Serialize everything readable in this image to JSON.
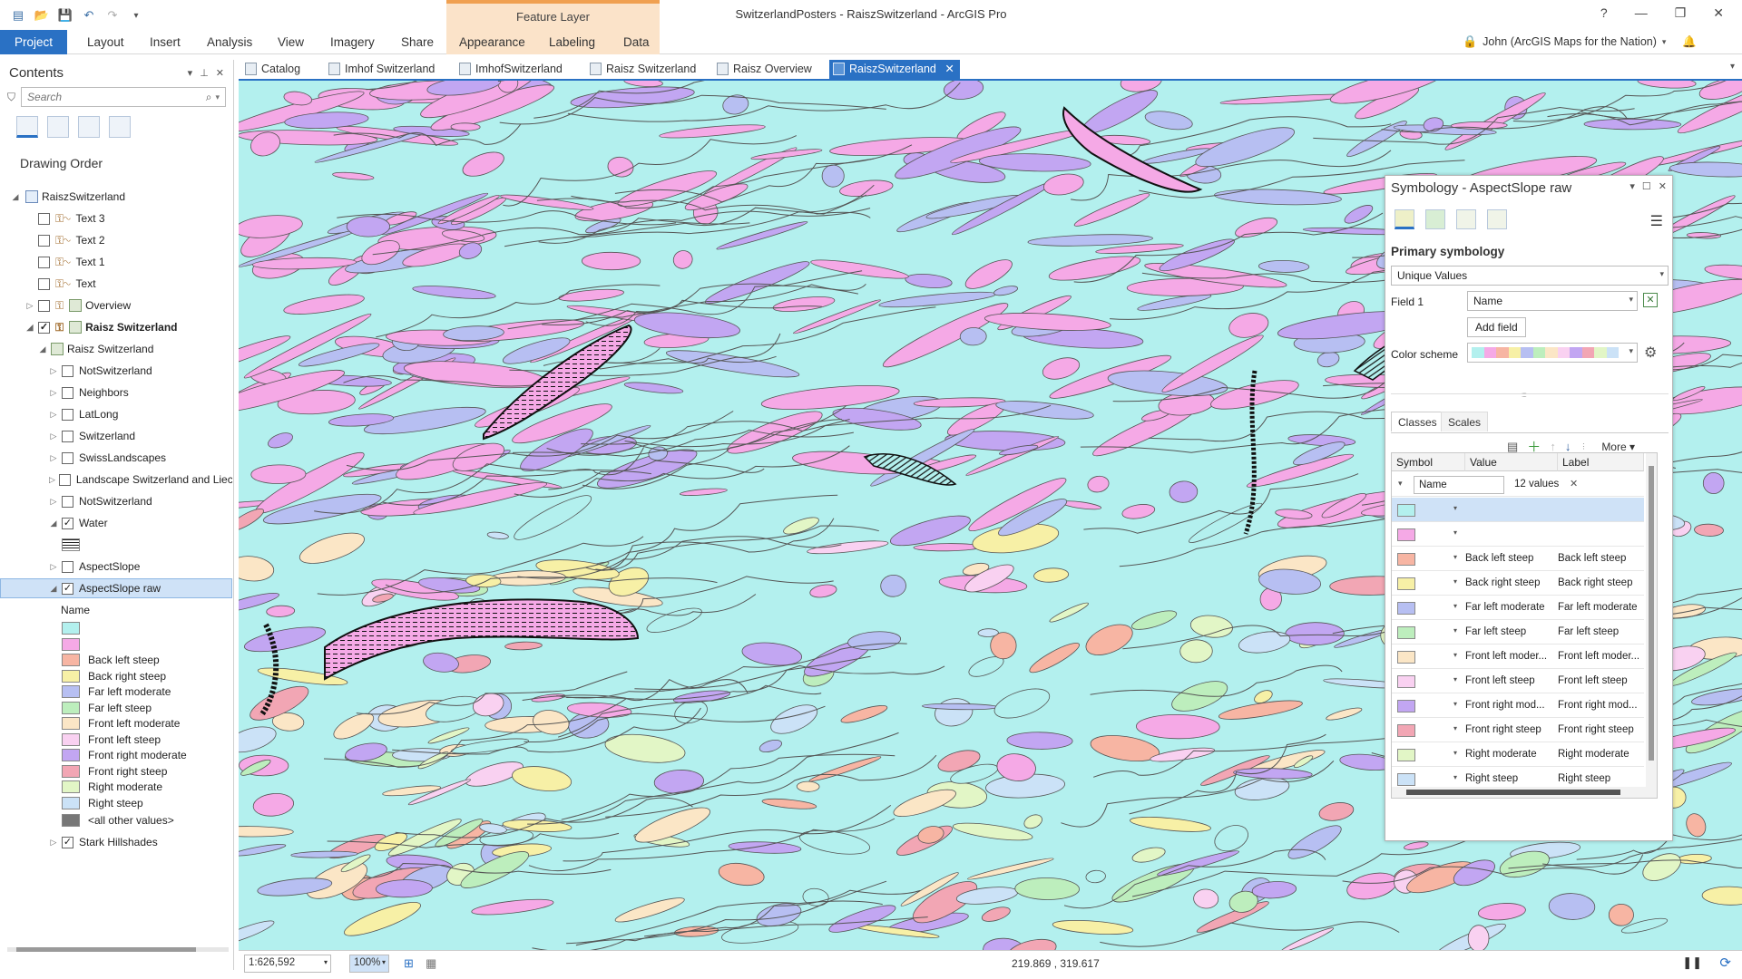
{
  "app": {
    "title": "SwitzerlandPosters - RaiszSwitzerland - ArcGIS Pro",
    "context_header": "Feature Layer",
    "window_controls": [
      "?",
      "—",
      "❐",
      "✕"
    ]
  },
  "ribbon": {
    "tabs": [
      "Project",
      "Layout",
      "Insert",
      "Analysis",
      "View",
      "Imagery",
      "Share",
      "Appearance",
      "Labeling",
      "Data"
    ],
    "user": "John (ArcGIS Maps for the Nation)"
  },
  "contents": {
    "title": "Contents",
    "search_placeholder": "Search",
    "drawing_order_label": "Drawing Order",
    "map_name": "RaiszSwitzerland",
    "layers": [
      {
        "label": "Text 3",
        "checked": false,
        "expanded": null
      },
      {
        "label": "Text 2",
        "checked": false,
        "expanded": null
      },
      {
        "label": "Text 1",
        "checked": false,
        "expanded": null
      },
      {
        "label": "Text",
        "checked": false,
        "expanded": null
      },
      {
        "label": "Overview",
        "checked": false,
        "expanded": false
      },
      {
        "label": "Raisz Switzerland",
        "checked": true,
        "expanded": true
      }
    ],
    "group_name": "Raisz Switzerland",
    "sublayers": [
      {
        "label": "NotSwitzerland",
        "checked": false
      },
      {
        "label": "Neighbors",
        "checked": false
      },
      {
        "label": "LatLong",
        "checked": false
      },
      {
        "label": "Switzerland",
        "checked": false
      },
      {
        "label": "SwissLandscapes",
        "checked": false
      },
      {
        "label": "Landscape Switzerland and Liech",
        "checked": false
      },
      {
        "label": "NotSwitzerland",
        "checked": false
      },
      {
        "label": "Water",
        "checked": true
      }
    ],
    "aspect_slope": "AspectSlope",
    "aspect_slope_raw": "AspectSlope raw",
    "legend_field": "Name",
    "legend_items": [
      {
        "label": "",
        "color": "#b3f0ee"
      },
      {
        "label": "",
        "color": "#f5a9e6"
      },
      {
        "label": "Back left steep",
        "color": "#f7b5a3"
      },
      {
        "label": "Back right steep",
        "color": "#f7f0a6"
      },
      {
        "label": "Far left moderate",
        "color": "#b7bff2"
      },
      {
        "label": "Far left steep",
        "color": "#bdeebd"
      },
      {
        "label": "Front left moderate",
        "color": "#fbe6c6"
      },
      {
        "label": "Front left steep",
        "color": "#f9d1f1"
      },
      {
        "label": "Front right moderate",
        "color": "#c2a6f2"
      },
      {
        "label": "Front right steep",
        "color": "#f2a6b4"
      },
      {
        "label": "Right moderate",
        "color": "#e2f6c6"
      },
      {
        "label": "Right steep",
        "color": "#cbe2f7"
      }
    ],
    "all_other_values": "<all other values>",
    "stark_hillshades": "Stark Hillshades"
  },
  "doc_tabs": [
    "Catalog",
    "Imhof Switzerland",
    "ImhofSwitzerland",
    "Raisz Switzerland",
    "Raisz Overview",
    "RaiszSwitzerland"
  ],
  "symbology": {
    "title": "Symbology - AspectSlope raw",
    "primary_label": "Primary symbology",
    "method": "Unique Values",
    "field1_label": "Field 1",
    "field1_value": "Name",
    "add_field": "Add field",
    "color_scheme_label": "Color scheme",
    "subtabs": [
      "Classes",
      "Scales"
    ],
    "more": "More",
    "columns": [
      "Symbol",
      "Value",
      "Label"
    ],
    "group_field": "Name",
    "group_count": "12 values",
    "rows": [
      {
        "value": "",
        "label": "",
        "color": "#b3f0ee"
      },
      {
        "value": "",
        "label": "",
        "color": "#f5a9e6"
      },
      {
        "value": "Back left steep",
        "label": "Back left steep",
        "color": "#f7b5a3"
      },
      {
        "value": "Back right steep",
        "label": "Back right steep",
        "color": "#f7f0a6"
      },
      {
        "value": "Far left moderate",
        "label": "Far left moderate",
        "color": "#b7bff2"
      },
      {
        "value": "Far left steep",
        "label": "Far left steep",
        "color": "#bdeebd"
      },
      {
        "value": "Front left moder...",
        "label": "Front left moder...",
        "color": "#fbe6c6"
      },
      {
        "value": "Front left steep",
        "label": "Front left steep",
        "color": "#f9d1f1"
      },
      {
        "value": "Front right mod...",
        "label": "Front right mod...",
        "color": "#c2a6f2"
      },
      {
        "value": "Front right steep",
        "label": "Front right steep",
        "color": "#f2a6b4"
      },
      {
        "value": "Right moderate",
        "label": "Right moderate",
        "color": "#e2f6c6"
      },
      {
        "value": "Right steep",
        "label": "Right steep",
        "color": "#cbe2f7"
      }
    ]
  },
  "status": {
    "scale": "1:626,592",
    "zoom": "100%",
    "coords": "219.869 , 319.617"
  },
  "colors": {
    "accent": "#2a71c4",
    "context": "#fbe3c9",
    "map_bg": "#b3f0ee"
  }
}
